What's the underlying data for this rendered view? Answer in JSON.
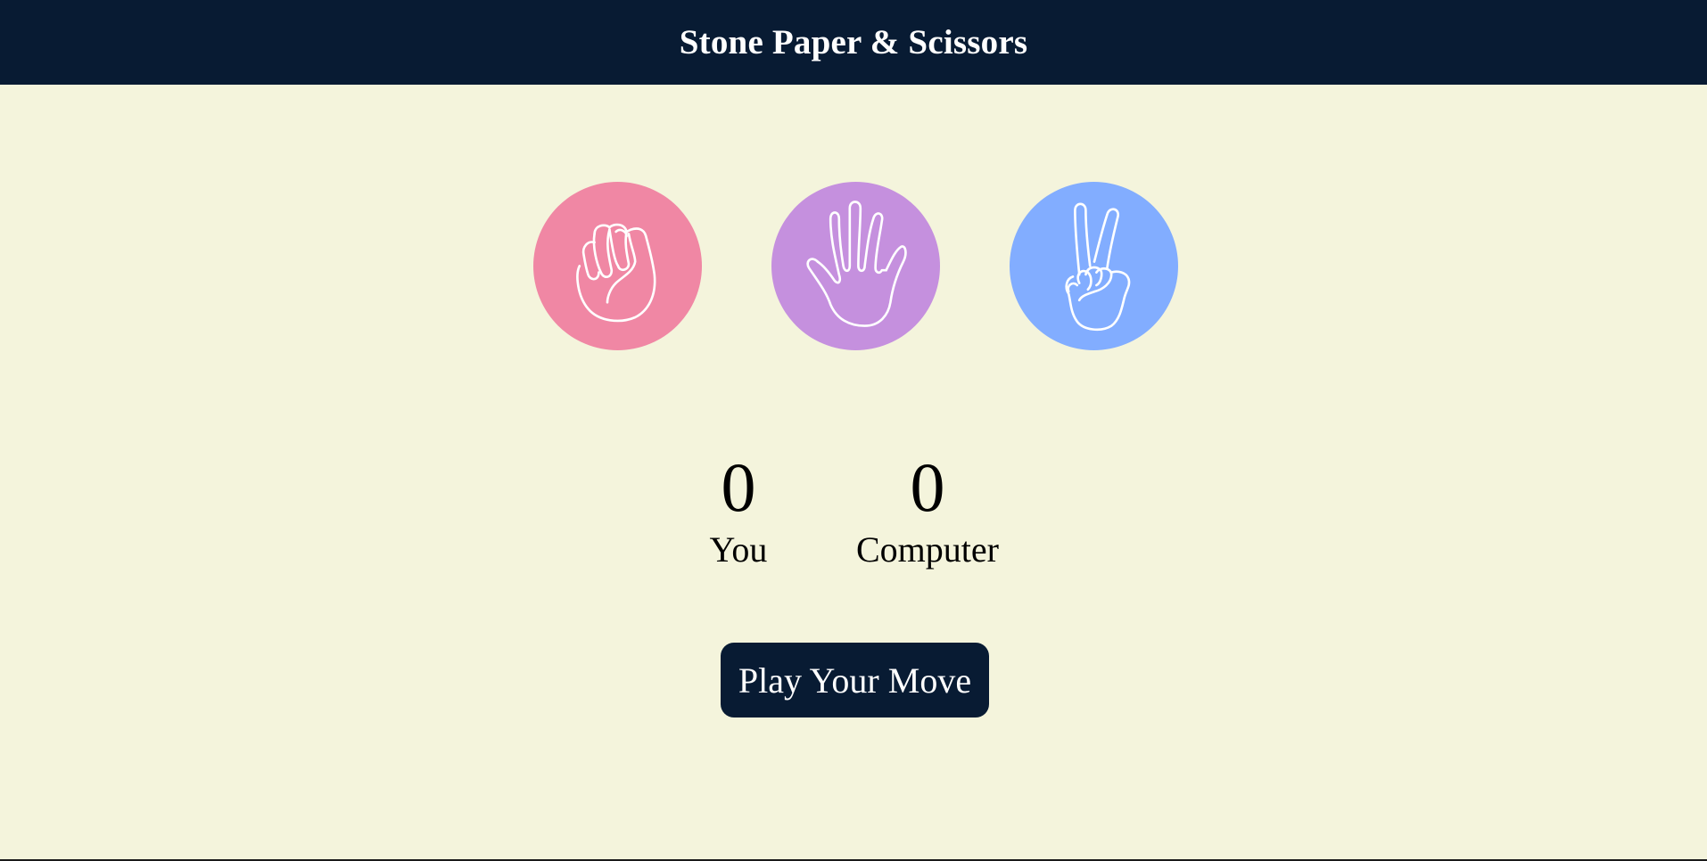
{
  "header": {
    "title": "Stone Paper & Scissors"
  },
  "choices": [
    {
      "name": "stone",
      "icon": "fist-icon",
      "color": "#f087a4"
    },
    {
      "name": "paper",
      "icon": "open-hand-icon",
      "color": "#c590de"
    },
    {
      "name": "scissors",
      "icon": "peace-hand-icon",
      "color": "#82adff"
    }
  ],
  "scores": {
    "user": {
      "value": "0",
      "label": "You"
    },
    "computer": {
      "value": "0",
      "label": "Computer"
    }
  },
  "message": {
    "text": "Play Your Move"
  },
  "colors": {
    "header_bg": "#081b33",
    "page_bg": "#f4f4dc",
    "button_bg": "#081b33"
  }
}
